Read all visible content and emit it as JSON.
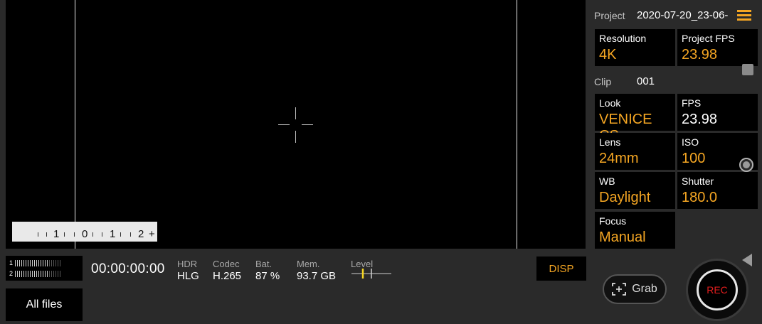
{
  "viewfinder": {
    "ev_scale": {
      "labels": [
        "1",
        "0",
        "1",
        "2",
        "+"
      ]
    }
  },
  "bottom_bar": {
    "audio_meter": {
      "ch1": "1",
      "ch2": "2"
    },
    "timecode": "00:00:00:00",
    "hdr": {
      "label": "HDR",
      "value": "HLG"
    },
    "codec": {
      "label": "Codec",
      "value": "H.265"
    },
    "battery": {
      "label": "Bat.",
      "value": "87 %"
    },
    "memory": {
      "label": "Mem.",
      "value": "93.7 GB"
    },
    "level": {
      "label": "Level"
    },
    "disp_label": "DISP",
    "all_files_label": "All files"
  },
  "panel": {
    "project_label": "Project",
    "project_name": "2020-07-20_23-06-",
    "clip_label": "Clip",
    "clip_value": "001",
    "cells": {
      "resolution": {
        "label": "Resolution",
        "value": "4K"
      },
      "project_fps": {
        "label": "Project FPS",
        "value": "23.98"
      },
      "look": {
        "label": "Look",
        "value": "VENICE CS"
      },
      "fps": {
        "label": "FPS",
        "value": "23.98"
      },
      "lens": {
        "label": "Lens",
        "value": "24mm"
      },
      "iso": {
        "label": "ISO",
        "value": "100"
      },
      "wb": {
        "label": "WB",
        "value": "Daylight"
      },
      "shutter": {
        "label": "Shutter",
        "value": "180.0"
      },
      "focus": {
        "label": "Focus",
        "value": "Manual"
      }
    },
    "grab_label": "Grab",
    "rec_label": "REC"
  },
  "colors": {
    "accent": "#f5a623",
    "rec": "#e21d1d",
    "panel_bg": "#2a2a2a",
    "cell_bg": "#000000"
  },
  "icons": [
    "menu-icon",
    "grab-icon",
    "record-icon",
    "collapse-arrow-icon",
    "crosshair-icon"
  ]
}
